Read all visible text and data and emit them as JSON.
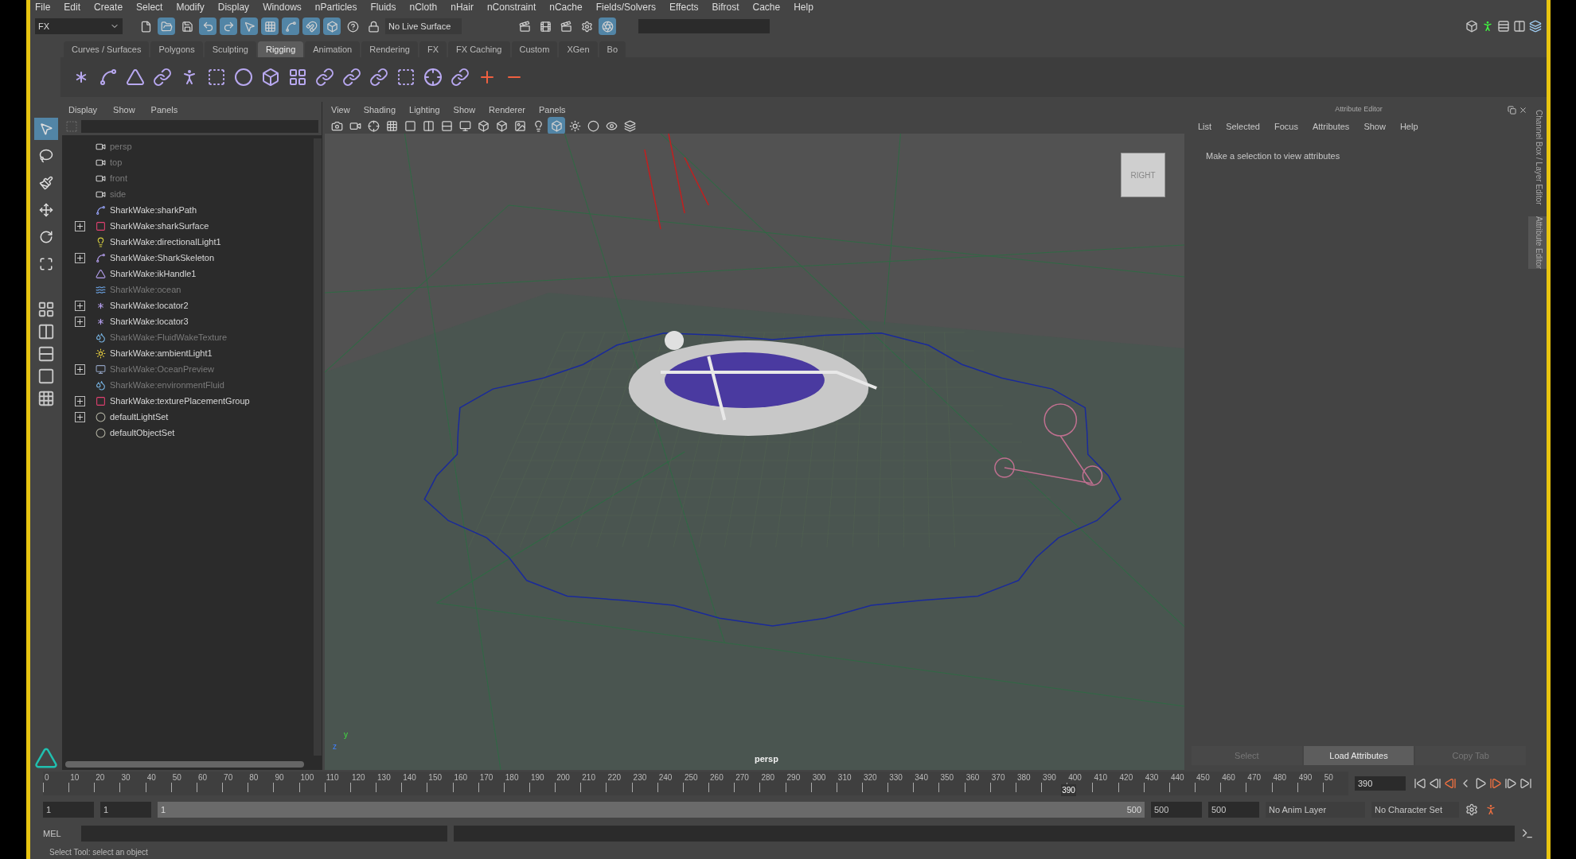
{
  "menu_bar": [
    "File",
    "Edit",
    "Create",
    "Select",
    "Modify",
    "Display",
    "Windows",
    "nParticles",
    "Fluids",
    "nCloth",
    "nHair",
    "nConstraint",
    "nCache",
    "Fields/Solvers",
    "Effects",
    "Bifrost",
    "Cache",
    "Help"
  ],
  "status_line": {
    "menu_set": "FX",
    "live_surface": "No Live Surface",
    "toggles": [
      {
        "on": false
      },
      {
        "on": true
      },
      {
        "on": false
      },
      {
        "on": true
      },
      {
        "on": true
      },
      {
        "on": true
      },
      {
        "on": true
      },
      {
        "on": true
      },
      {
        "on": true
      },
      {
        "on": true
      },
      {
        "on": false
      },
      {
        "on": false
      }
    ],
    "render_toggles": [
      {
        "on": false
      },
      {
        "on": false
      },
      {
        "on": false
      },
      {
        "on": false
      },
      {
        "on": true
      }
    ]
  },
  "shelf": {
    "tabs": [
      {
        "label": "Curves / Surfaces",
        "selected": false
      },
      {
        "label": "Polygons",
        "selected": false
      },
      {
        "label": "Sculpting",
        "selected": false
      },
      {
        "label": "Rigging",
        "selected": true
      },
      {
        "label": "Animation",
        "selected": false
      },
      {
        "label": "Rendering",
        "selected": false
      },
      {
        "label": "FX",
        "selected": false
      },
      {
        "label": "FX Caching",
        "selected": false
      },
      {
        "label": "Custom",
        "selected": false
      },
      {
        "label": "XGen",
        "selected": false
      },
      {
        "label": "Bo",
        "selected": false
      }
    ]
  },
  "toolbox": [
    {
      "selected": true
    },
    {
      "selected": false
    },
    {
      "selected": false
    },
    {
      "selected": false
    },
    {
      "selected": false
    },
    {
      "selected": false
    }
  ],
  "outliner": {
    "menu": [
      "Display",
      "Show",
      "Panels"
    ],
    "items": [
      {
        "label": "persp",
        "kind": "camera",
        "dimmed": true,
        "has_children": false
      },
      {
        "label": "top",
        "kind": "camera",
        "dimmed": true,
        "has_children": false
      },
      {
        "label": "front",
        "kind": "camera",
        "dimmed": true,
        "has_children": false
      },
      {
        "label": "side",
        "kind": "camera",
        "dimmed": true,
        "has_children": false
      },
      {
        "label": "SharkWake:sharkPath",
        "kind": "curve",
        "dimmed": false,
        "has_children": false
      },
      {
        "label": "SharkWake:sharkSurface",
        "kind": "surface",
        "dimmed": false,
        "has_children": true
      },
      {
        "label": "SharkWake:directionalLight1",
        "kind": "light",
        "dimmed": false,
        "has_children": false
      },
      {
        "label": "SharkWake:SharkSkeleton",
        "kind": "joint",
        "dimmed": false,
        "has_children": true
      },
      {
        "label": "SharkWake:ikHandle1",
        "kind": "ik",
        "dimmed": false,
        "has_children": false
      },
      {
        "label": "SharkWake:ocean",
        "kind": "plane",
        "dimmed": true,
        "has_children": false
      },
      {
        "label": "SharkWake:locator2",
        "kind": "locator",
        "dimmed": false,
        "has_children": true
      },
      {
        "label": "SharkWake:locator3",
        "kind": "locator",
        "dimmed": false,
        "has_children": true
      },
      {
        "label": "SharkWake:FluidWakeTexture",
        "kind": "fluid",
        "dimmed": true,
        "has_children": false
      },
      {
        "label": "SharkWake:ambientLight1",
        "kind": "sun",
        "dimmed": false,
        "has_children": false
      },
      {
        "label": "SharkWake:OceanPreview",
        "kind": "preview",
        "dimmed": true,
        "has_children": true
      },
      {
        "label": "SharkWake:environmentFluid",
        "kind": "fluid",
        "dimmed": true,
        "has_children": false
      },
      {
        "label": "SharkWake:texturePlacementGroup",
        "kind": "surface",
        "dimmed": false,
        "has_children": true
      },
      {
        "label": "defaultLightSet",
        "kind": "set",
        "dimmed": false,
        "has_children": true
      },
      {
        "label": "defaultObjectSet",
        "kind": "set",
        "dimmed": false,
        "has_children": false
      }
    ]
  },
  "viewport": {
    "menu": [
      "View",
      "Shading",
      "Lighting",
      "Show",
      "Renderer",
      "Panels"
    ],
    "toggles": [
      {
        "on": false
      },
      {
        "on": false
      },
      {
        "on": false
      },
      {
        "on": false
      },
      {
        "on": false
      },
      {
        "on": false
      },
      {
        "on": false
      },
      {
        "on": false
      },
      {
        "on": false
      },
      {
        "on": false
      },
      {
        "on": false
      },
      {
        "on": false
      },
      {
        "on": true
      },
      {
        "on": false
      },
      {
        "on": false
      },
      {
        "on": false
      },
      {
        "on": false
      }
    ],
    "view_cube": "RIGHT",
    "camera": "persp",
    "axis_labels": [
      "y",
      "z"
    ]
  },
  "attribute_editor": {
    "title": "Attribute Editor",
    "menu": [
      "List",
      "Selected",
      "Focus",
      "Attributes",
      "Show",
      "Help"
    ],
    "message": "Make a selection to view attributes",
    "buttons": [
      {
        "label": "Select",
        "disabled": true
      },
      {
        "label": "Load Attributes",
        "disabled": false
      },
      {
        "label": "Copy Tab",
        "disabled": true
      }
    ],
    "side_tabs": [
      "Channel Box / Layer Editor",
      "Attribute Editor"
    ]
  },
  "time_slider": {
    "ticks": [
      "0",
      "10",
      "20",
      "30",
      "40",
      "50",
      "60",
      "70",
      "80",
      "90",
      "100",
      "110",
      "120",
      "130",
      "140",
      "150",
      "160",
      "170",
      "180",
      "190",
      "200",
      "210",
      "220",
      "230",
      "240",
      "250",
      "260",
      "270",
      "280",
      "290",
      "300",
      "310",
      "320",
      "330",
      "340",
      "350",
      "360",
      "370",
      "380",
      "390",
      "400",
      "410",
      "420",
      "430",
      "440",
      "450",
      "460",
      "470",
      "480",
      "490",
      "50"
    ],
    "marker_label": "390",
    "level": 0.78,
    "current_frame": "390"
  },
  "range_slider": {
    "level": 1,
    "start": "1",
    "playback_start": "1",
    "range_start": "1",
    "range_end": "500",
    "playback_end": "500",
    "end": "500",
    "anim_layer": "No Anim Layer",
    "character_set": "No Character Set"
  },
  "command_line": {
    "language": "MEL"
  },
  "help_line": "Select Tool: select an object"
}
